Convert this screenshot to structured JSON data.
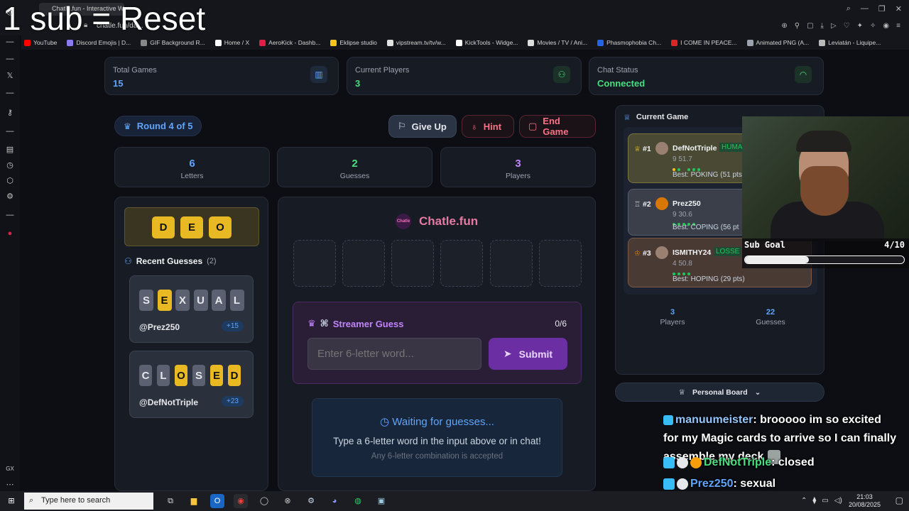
{
  "overlay_title": "1 sub = Reset",
  "browser": {
    "tab_title": "Chatle.fun - Interactive W...",
    "address": "chatle.fun/da...",
    "bookmarks": [
      {
        "label": "YouTube",
        "color": "#ff0000"
      },
      {
        "label": "Discord Emojis | D...",
        "color": "#8b7cf6"
      },
      {
        "label": "GIF Background R...",
        "color": "#888888"
      },
      {
        "label": "Home / X",
        "color": "#ffffff"
      },
      {
        "label": "AeroKick - Dashb...",
        "color": "#e11d48"
      },
      {
        "label": "Eklipse studio",
        "color": "#f5c518"
      },
      {
        "label": "vipstream.tv/tv/w...",
        "color": "#e2e2e2"
      },
      {
        "label": "KickTools - Widge...",
        "color": "#ffffff"
      },
      {
        "label": "Movies / TV / Ani...",
        "color": "#dddddd"
      },
      {
        "label": "Phasmophobia Ch...",
        "color": "#2563eb"
      },
      {
        "label": "I COME IN PEACE...",
        "color": "#dc2626"
      },
      {
        "label": "Animated PNG (A...",
        "color": "#9ca3af"
      },
      {
        "label": "Leviatán - Liquipe...",
        "color": "#bbbbbb"
      }
    ]
  },
  "stats": [
    {
      "label": "Total Games",
      "value": "15",
      "icon": "bar-chart-icon",
      "color": "#60a5fa"
    },
    {
      "label": "Current Players",
      "value": "3",
      "icon": "user-icon",
      "color": "#4ade80"
    },
    {
      "label": "Chat Status",
      "value": "Connected",
      "icon": "wifi-icon",
      "color": "#4ade80"
    }
  ],
  "round": {
    "label": "Round 4 of 5"
  },
  "actions": {
    "give_up": "Give Up",
    "hint": "Hint",
    "end_game": "End Game"
  },
  "counters": [
    {
      "value": "6",
      "label": "Letters",
      "color": "#60a5fa"
    },
    {
      "value": "2",
      "label": "Guesses",
      "color": "#4ade80"
    },
    {
      "value": "3",
      "label": "Players",
      "color": "#c084fc"
    }
  ],
  "known_letters": [
    "D",
    "E",
    "O"
  ],
  "recent_guesses": {
    "title": "Recent Guesses",
    "count": "(2)",
    "items": [
      {
        "letters": [
          {
            "c": "S",
            "y": false
          },
          {
            "c": "E",
            "y": true
          },
          {
            "c": "X",
            "y": false
          },
          {
            "c": "U",
            "y": false
          },
          {
            "c": "A",
            "y": false
          },
          {
            "c": "L",
            "y": false
          }
        ],
        "user": "@Prez250",
        "points": "+15"
      },
      {
        "letters": [
          {
            "c": "C",
            "y": false
          },
          {
            "c": "L",
            "y": false
          },
          {
            "c": "O",
            "y": true
          },
          {
            "c": "S",
            "y": false
          },
          {
            "c": "E",
            "y": true
          },
          {
            "c": "D",
            "y": true
          }
        ],
        "user": "@DefNotTriple",
        "points": "+23"
      }
    ]
  },
  "brand": {
    "name": "Chatle.fun",
    "logo_text": "Chatle"
  },
  "streamer_guess": {
    "title": "Streamer Guess",
    "count": "0/6",
    "placeholder": "Enter 6-letter word...",
    "submit": "Submit"
  },
  "waiting": {
    "title": "Waiting for guesses...",
    "line1": "Type a 6-letter word in the input above or in chat!",
    "line2": "Any 6-letter combination is accepted"
  },
  "current_game": {
    "title": "Current Game",
    "players": [
      {
        "rank": "#1",
        "name": "DefNotTriple",
        "tag": "HUMA",
        "meta": "9   51.7",
        "best": "Best: POKING (51 pts)",
        "bg": "#4a4a34",
        "border": "#7a7440",
        "tag_color": "#22c55e"
      },
      {
        "rank": "#2",
        "name": "Prez250",
        "tag": "",
        "meta": "9   30.6",
        "best": "Best: COPING (56 pt",
        "bg": "#3a3f4a",
        "border": "#555c6a",
        "tag_color": ""
      },
      {
        "rank": "#3",
        "name": "ISMITHY24",
        "tag": "LOSSE",
        "meta": "4   50.8",
        "best": "Best: HOPING (29 pts)",
        "bg": "#4a3a34",
        "border": "#7a5a46",
        "tag_color": "#22c55e",
        "pts": "pts"
      }
    ],
    "summary": [
      {
        "value": "3",
        "label": "Players"
      },
      {
        "value": "22",
        "label": "Guesses"
      }
    ]
  },
  "personal_board": {
    "label": "Personal Board"
  },
  "sub_goal": {
    "label": "Sub Goal",
    "count": "4/10",
    "progress": 0.4
  },
  "chat": [
    {
      "user": "manuumeister",
      "user_color": "#93c5fd",
      "text": ": brooooo im so excited"
    },
    {
      "user": "",
      "user_color": "",
      "text": "for my Magic cards to arrive so I can finally"
    },
    {
      "user": "",
      "user_color": "",
      "text": "assemble my deck"
    },
    {
      "user": "DefNotTriple",
      "user_color": "#4ade80",
      "text": ": closed"
    },
    {
      "user": "Prez250",
      "user_color": "#60a5fa",
      "text": ": sexual"
    }
  ],
  "taskbar": {
    "search_placeholder": "Type here to search",
    "time": "21:03",
    "date": "20/08/2025"
  },
  "gx_label": "GX"
}
